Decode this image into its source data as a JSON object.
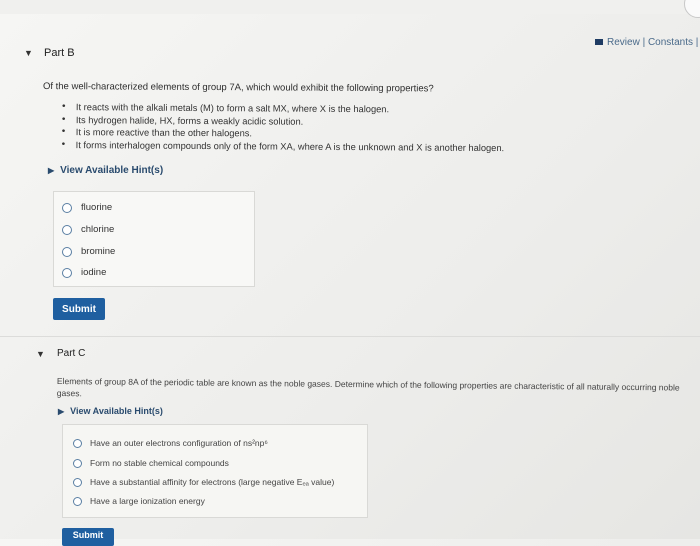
{
  "header": {
    "review_link": "Review | Constants | P",
    "book_icon": "book-icon"
  },
  "part_b": {
    "title": "Part B",
    "question": "Of the well-characterized elements of group 7A, which would exhibit the following properties?",
    "properties": [
      "It reacts with the alkali metals (M) to form a salt MX, where X is the halogen.",
      "Its hydrogen halide, HX, forms a weakly acidic solution.",
      "It is more reactive than the other halogens.",
      "It forms interhalogen compounds only of the form XA, where A is the unknown and X is another halogen."
    ],
    "hints_label": "View Available Hint(s)",
    "options": [
      "fluorine",
      "chlorine",
      "bromine",
      "iodine"
    ],
    "submit_label": "Submit"
  },
  "part_c": {
    "title": "Part C",
    "question_line1": "Elements of group 8A of the periodic table are known as the noble gases. Determine which of the following properties are characteristic of all naturally occurring noble",
    "question_line2": "gases.",
    "hints_label": "View Available Hint(s)",
    "options": [
      "Have an outer electrons configuration of ns²np⁶",
      "Form no stable chemical compounds",
      "Have a substantial affinity for electrons (large negative Eₑₐ value)",
      "Have a large ionization energy"
    ],
    "submit_label": "Submit"
  },
  "colors": {
    "accent": "#1f5fa0",
    "link": "#2a4b6e"
  }
}
